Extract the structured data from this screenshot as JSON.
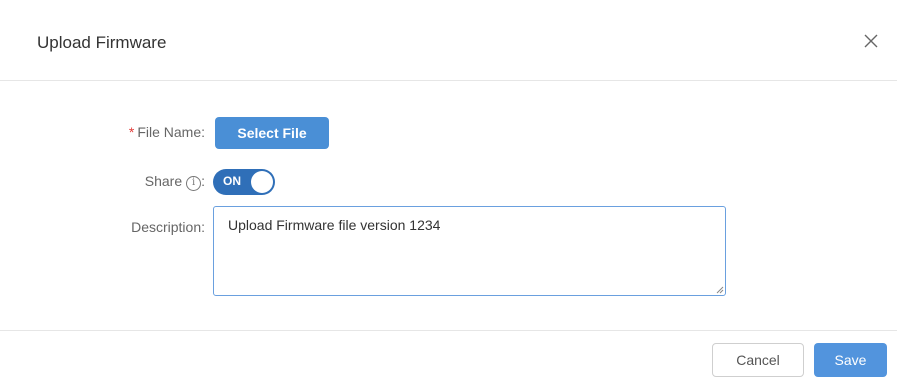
{
  "dialog": {
    "title": "Upload Firmware",
    "close_icon": "close-icon"
  },
  "form": {
    "file_name": {
      "required_mark": "*",
      "label": "File Name",
      "separator": ":",
      "button_label": "Select File"
    },
    "share": {
      "label": "Share",
      "info_icon": "info-icon",
      "info_glyph": "i",
      "separator": ":",
      "toggle_text": "ON",
      "toggle_state": "on",
      "toggle_color": "#2f6fb8"
    },
    "description": {
      "label": "Description",
      "separator": ":",
      "value": "Upload Firmware file version 1234"
    }
  },
  "footer": {
    "cancel_label": "Cancel",
    "save_label": "Save",
    "save_color": "#5294dd"
  },
  "colors": {
    "accent": "#4a8fd6",
    "required": "#e23c39"
  }
}
